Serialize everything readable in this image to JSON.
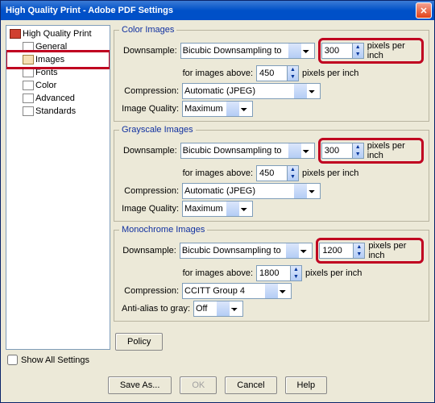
{
  "title": "High Quality Print - Adobe PDF Settings",
  "tree": {
    "root": "High Quality Print",
    "items": [
      "General",
      "Images",
      "Fonts",
      "Color",
      "Advanced",
      "Standards"
    ]
  },
  "showall": "Show All Settings",
  "sections": {
    "color": {
      "legend": "Color Images",
      "downsample_label": "Downsample:",
      "downsample_method": "Bicubic Downsampling to",
      "downsample_value": "300",
      "above_label": "for images above:",
      "above_value": "450",
      "unit": "pixels per inch",
      "comp_label": "Compression:",
      "comp_value": "Automatic (JPEG)",
      "qual_label": "Image Quality:",
      "qual_value": "Maximum"
    },
    "gray": {
      "legend": "Grayscale Images",
      "downsample_label": "Downsample:",
      "downsample_method": "Bicubic Downsampling to",
      "downsample_value": "300",
      "above_label": "for images above:",
      "above_value": "450",
      "unit": "pixels per inch",
      "comp_label": "Compression:",
      "comp_value": "Automatic (JPEG)",
      "qual_label": "Image Quality:",
      "qual_value": "Maximum"
    },
    "mono": {
      "legend": "Monochrome Images",
      "downsample_label": "Downsample:",
      "downsample_method": "Bicubic Downsampling to",
      "downsample_value": "1200",
      "above_label": "for images above:",
      "above_value": "1800",
      "unit": "pixels per inch",
      "comp_label": "Compression:",
      "comp_value": "CCITT Group 4",
      "aa_label": "Anti-alias to gray:",
      "aa_value": "Off"
    }
  },
  "policy": "Policy",
  "footer": {
    "saveas": "Save As...",
    "ok": "OK",
    "cancel": "Cancel",
    "help": "Help"
  }
}
